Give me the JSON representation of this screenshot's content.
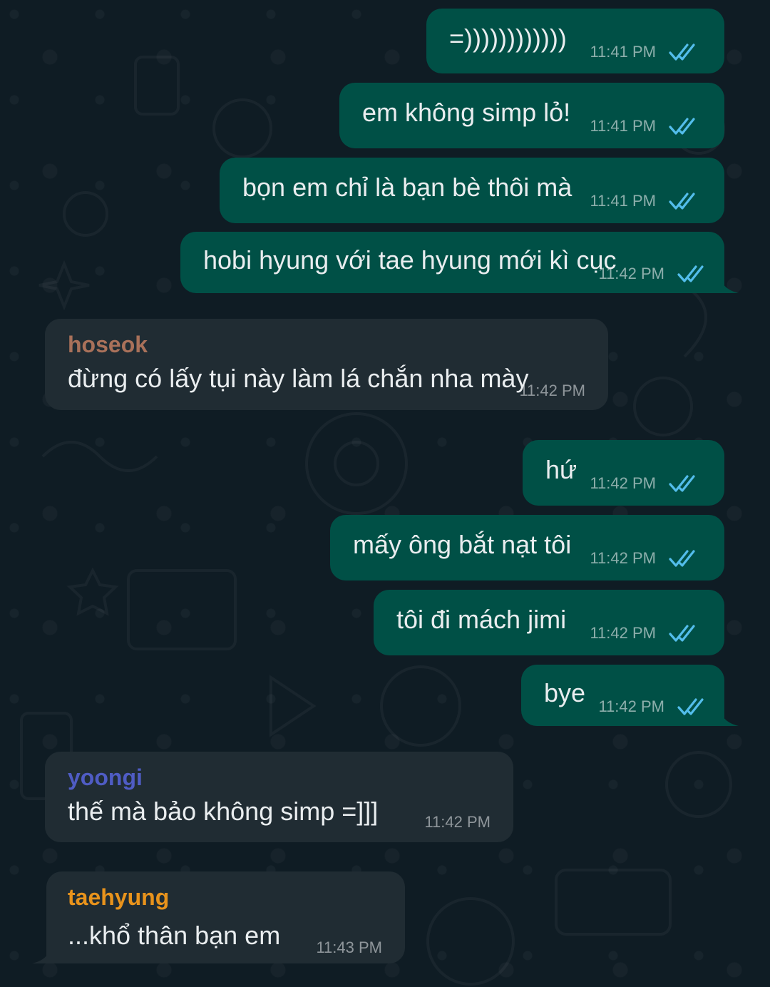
{
  "theme": {
    "background": "#0f1c24",
    "outgoing_bubble": "#005046",
    "incoming_bubble": "#202c33",
    "read_tick_color": "#53bdeb"
  },
  "messages": [
    {
      "direction": "out",
      "text": "=))))))))))))",
      "time": "11:41 PM",
      "status": "read-double-tick-icon"
    },
    {
      "direction": "out",
      "text": "em không simp lỏ!",
      "time": "11:41 PM",
      "status": "read-double-tick-icon"
    },
    {
      "direction": "out",
      "text": "bọn em chỉ là bạn bè thôi mà",
      "time": "11:41 PM",
      "status": "read-double-tick-icon"
    },
    {
      "direction": "out",
      "text": "hobi hyung với tae hyung mới kì cục",
      "time": "11:42 PM",
      "status": "read-double-tick-icon"
    },
    {
      "direction": "in",
      "sender": "hoseok",
      "sender_color": "#a9715a",
      "text": "đừng có lấy tụi này làm lá chắn nha mày",
      "time": "11:42 PM"
    },
    {
      "direction": "out",
      "text": "hứ",
      "time": "11:42 PM",
      "status": "read-double-tick-icon"
    },
    {
      "direction": "out",
      "text": "mấy ông bắt nạt tôi",
      "time": "11:42 PM",
      "status": "read-double-tick-icon"
    },
    {
      "direction": "out",
      "text": "tôi đi mách jimi",
      "time": "11:42 PM",
      "status": "read-double-tick-icon"
    },
    {
      "direction": "out",
      "text": "bye",
      "time": "11:42 PM",
      "status": "read-double-tick-icon"
    },
    {
      "direction": "in",
      "sender": "yoongi",
      "sender_color": "#4f5cc4",
      "text": "thế mà bảo không simp =]]]",
      "time": "11:42 PM"
    },
    {
      "direction": "in",
      "sender": "taehyung",
      "sender_color": "#e8931c",
      "text": "...khổ thân bạn em",
      "time": "11:43 PM"
    }
  ]
}
